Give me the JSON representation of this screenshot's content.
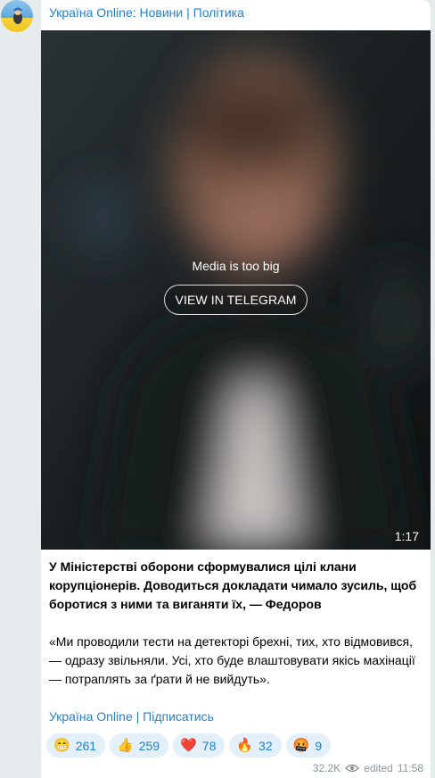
{
  "channel": {
    "name": "Україна Online: Новини | Політика"
  },
  "media": {
    "note": "Media is too big",
    "button_label": "VIEW IN TELEGRAM",
    "duration": "1:17"
  },
  "post": {
    "headline": "У Міністерстві оборони сформувалися цілі клани корупціонерів. Доводиться докладати чимало зусиль, щоб боротися з ними та виганяти їх, — Федоров",
    "quote": "«Ми проводили тести на детекторі брехні, тих, хто відмовився, — одразу звільняли. Усі, хто буде влаштовувати якісь махінації — потраплять за ґрати й не вийдуть».",
    "signature_link": "Україна Online | Підписатись"
  },
  "reactions": [
    {
      "emoji": "😁",
      "icon": "grinning-face-icon",
      "count": "261"
    },
    {
      "emoji": "👍",
      "icon": "thumbs-up-icon",
      "count": "259"
    },
    {
      "emoji": "❤️",
      "icon": "heart-icon",
      "count": "78"
    },
    {
      "emoji": "🔥",
      "icon": "fire-icon",
      "count": "32"
    },
    {
      "emoji": "🤬",
      "icon": "cursing-face-icon",
      "count": "9"
    }
  ],
  "meta": {
    "views": "32.2K",
    "edited_label": "edited",
    "time": "11:58"
  },
  "colors": {
    "link": "#2481cc",
    "reaction_bg": "#e3eff9",
    "page_bg": "#e6ebee"
  }
}
